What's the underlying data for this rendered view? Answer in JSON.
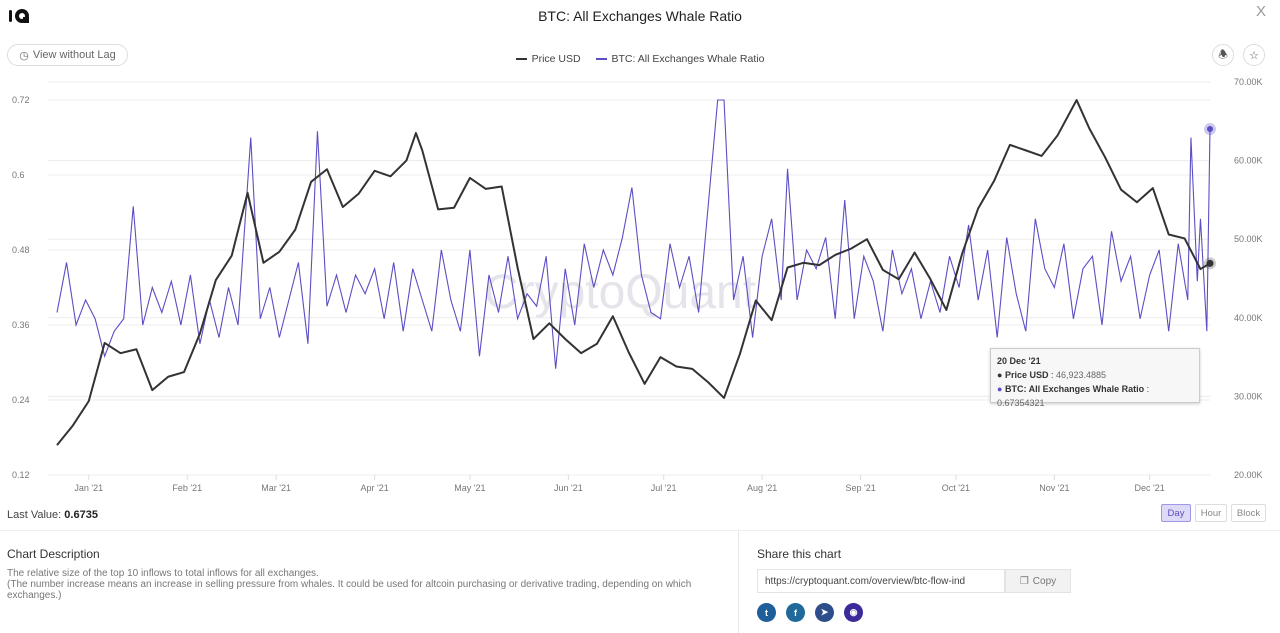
{
  "header": {
    "title": "BTC: All Exchanges Whale Ratio",
    "close_label": "X",
    "view_without_lag": "View without Lag"
  },
  "icons": {
    "logo": "cryptoquant-logo",
    "alert": "bell-icon",
    "favorite": "star-icon",
    "clock": "clock-icon",
    "copy": "copy-icon"
  },
  "colors": {
    "price": "#333333",
    "ratio": "#5b4fc4",
    "accent": "#5b4fc4"
  },
  "watermark": "CryptoQuant",
  "tooltip": {
    "date": "20 Dec '21",
    "price_label": "Price USD",
    "price_value": "46,923.4885",
    "ratio_label": "BTC: All Exchanges Whale Ratio",
    "ratio_value": "0.67354321"
  },
  "footer": {
    "last_value_label": "Last Value:",
    "last_value": "0.6735",
    "resolutions": [
      "Day",
      "Hour",
      "Block"
    ],
    "active_resolution": "Day"
  },
  "description": {
    "title": "Chart Description",
    "line1": "The relative size of the top 10 inflows to total inflows for all exchanges.",
    "line2": "(The number increase means an increase in selling pressure from whales. It could be used for altcoin purchasing or derivative trading, depending on which exchanges.)"
  },
  "share": {
    "title": "Share this chart",
    "url": "https://cryptoquant.com/overview/btc-flow-ind",
    "copy_label": "Copy",
    "networks": [
      "twitter",
      "facebook",
      "telegram",
      "camera"
    ]
  },
  "chart_data": {
    "type": "line",
    "title": "BTC: All Exchanges Whale Ratio",
    "legend": [
      "Price USD",
      "BTC: All Exchanges Whale Ratio"
    ],
    "legend_position": "top",
    "grid": true,
    "x_ticks": [
      "Jan '21",
      "Feb '21",
      "Mar '21",
      "Apr '21",
      "May '21",
      "Jun '21",
      "Jul '21",
      "Aug '21",
      "Sep '21",
      "Oct '21",
      "Nov '21",
      "Dec '21"
    ],
    "x_tick_dates": [
      "2021-01-01",
      "2021-02-01",
      "2021-03-01",
      "2021-04-01",
      "2021-05-01",
      "2021-06-01",
      "2021-07-01",
      "2021-08-01",
      "2021-09-01",
      "2021-10-01",
      "2021-11-01",
      "2021-12-01"
    ],
    "xlim": [
      "2020-12-22",
      "2021-12-20"
    ],
    "y_left": {
      "ticks": [
        "0.12",
        "0.24",
        "0.36",
        "0.48",
        "0.6",
        "0.72"
      ],
      "ylim": [
        0.12,
        0.72
      ]
    },
    "y_right": {
      "ticks": [
        "20.00K",
        "30.00K",
        "40.00K",
        "50.00K",
        "60.00K",
        "70.00K"
      ],
      "ylim": [
        20000,
        70000
      ]
    },
    "series": [
      {
        "name": "Price USD",
        "axis": "right",
        "points": [
          [
            "2020-12-22",
            23800
          ],
          [
            "2020-12-27",
            26300
          ],
          [
            "2021-01-01",
            29400
          ],
          [
            "2021-01-06",
            36800
          ],
          [
            "2021-01-11",
            35500
          ],
          [
            "2021-01-16",
            36000
          ],
          [
            "2021-01-21",
            30800
          ],
          [
            "2021-01-26",
            32500
          ],
          [
            "2021-01-31",
            33100
          ],
          [
            "2021-02-05",
            38000
          ],
          [
            "2021-02-10",
            44800
          ],
          [
            "2021-02-15",
            47900
          ],
          [
            "2021-02-20",
            55900
          ],
          [
            "2021-02-25",
            47000
          ],
          [
            "2021-03-02",
            48400
          ],
          [
            "2021-03-07",
            51200
          ],
          [
            "2021-03-12",
            57300
          ],
          [
            "2021-03-17",
            58900
          ],
          [
            "2021-03-22",
            54100
          ],
          [
            "2021-03-27",
            55800
          ],
          [
            "2021-04-01",
            58700
          ],
          [
            "2021-04-06",
            58000
          ],
          [
            "2021-04-11",
            60000
          ],
          [
            "2021-04-14",
            63500
          ],
          [
            "2021-04-16",
            61300
          ],
          [
            "2021-04-21",
            53800
          ],
          [
            "2021-04-26",
            54000
          ],
          [
            "2021-05-01",
            57800
          ],
          [
            "2021-05-06",
            56400
          ],
          [
            "2021-05-11",
            56700
          ],
          [
            "2021-05-16",
            46400
          ],
          [
            "2021-05-21",
            37300
          ],
          [
            "2021-05-26",
            39300
          ],
          [
            "2021-05-31",
            37300
          ],
          [
            "2021-06-05",
            35500
          ],
          [
            "2021-06-10",
            36700
          ],
          [
            "2021-06-15",
            40200
          ],
          [
            "2021-06-20",
            35600
          ],
          [
            "2021-06-25",
            31600
          ],
          [
            "2021-06-30",
            35000
          ],
          [
            "2021-07-05",
            33800
          ],
          [
            "2021-07-10",
            33500
          ],
          [
            "2021-07-15",
            31800
          ],
          [
            "2021-07-20",
            29800
          ],
          [
            "2021-07-25",
            35400
          ],
          [
            "2021-07-30",
            42200
          ],
          [
            "2021-08-04",
            39700
          ],
          [
            "2021-08-09",
            46400
          ],
          [
            "2021-08-14",
            47000
          ],
          [
            "2021-08-19",
            46700
          ],
          [
            "2021-08-24",
            48000
          ],
          [
            "2021-08-29",
            48800
          ],
          [
            "2021-09-03",
            50000
          ],
          [
            "2021-09-08",
            46100
          ],
          [
            "2021-09-13",
            44900
          ],
          [
            "2021-09-18",
            48300
          ],
          [
            "2021-09-23",
            44900
          ],
          [
            "2021-09-28",
            41000
          ],
          [
            "2021-10-03",
            48200
          ],
          [
            "2021-10-08",
            53900
          ],
          [
            "2021-10-13",
            57400
          ],
          [
            "2021-10-18",
            62000
          ],
          [
            "2021-10-23",
            61300
          ],
          [
            "2021-10-28",
            60600
          ],
          [
            "2021-11-02",
            63200
          ],
          [
            "2021-11-08",
            67700
          ],
          [
            "2021-11-12",
            64100
          ],
          [
            "2021-11-17",
            60400
          ],
          [
            "2021-11-22",
            56300
          ],
          [
            "2021-11-27",
            54700
          ],
          [
            "2021-12-02",
            56500
          ],
          [
            "2021-12-07",
            50600
          ],
          [
            "2021-12-12",
            50100
          ],
          [
            "2021-12-17",
            46200
          ],
          [
            "2021-12-20",
            46923.4885
          ]
        ]
      },
      {
        "name": "BTC: All Exchanges Whale Ratio",
        "axis": "left",
        "points": [
          [
            "2020-12-22",
            0.38
          ],
          [
            "2020-12-25",
            0.46
          ],
          [
            "2020-12-28",
            0.36
          ],
          [
            "2020-12-31",
            0.4
          ],
          [
            "2021-01-03",
            0.37
          ],
          [
            "2021-01-06",
            0.31
          ],
          [
            "2021-01-09",
            0.35
          ],
          [
            "2021-01-12",
            0.37
          ],
          [
            "2021-01-15",
            0.55
          ],
          [
            "2021-01-18",
            0.36
          ],
          [
            "2021-01-21",
            0.42
          ],
          [
            "2021-01-24",
            0.38
          ],
          [
            "2021-01-27",
            0.43
          ],
          [
            "2021-01-30",
            0.36
          ],
          [
            "2021-02-02",
            0.44
          ],
          [
            "2021-02-05",
            0.33
          ],
          [
            "2021-02-08",
            0.4
          ],
          [
            "2021-02-11",
            0.34
          ],
          [
            "2021-02-14",
            0.42
          ],
          [
            "2021-02-17",
            0.36
          ],
          [
            "2021-02-21",
            0.66
          ],
          [
            "2021-02-24",
            0.37
          ],
          [
            "2021-02-27",
            0.42
          ],
          [
            "2021-03-02",
            0.34
          ],
          [
            "2021-03-05",
            0.4
          ],
          [
            "2021-03-08",
            0.46
          ],
          [
            "2021-03-11",
            0.33
          ],
          [
            "2021-03-14",
            0.67
          ],
          [
            "2021-03-17",
            0.39
          ],
          [
            "2021-03-20",
            0.44
          ],
          [
            "2021-03-23",
            0.38
          ],
          [
            "2021-03-26",
            0.44
          ],
          [
            "2021-03-29",
            0.41
          ],
          [
            "2021-04-01",
            0.45
          ],
          [
            "2021-04-04",
            0.37
          ],
          [
            "2021-04-07",
            0.46
          ],
          [
            "2021-04-10",
            0.35
          ],
          [
            "2021-04-13",
            0.45
          ],
          [
            "2021-04-16",
            0.4
          ],
          [
            "2021-04-19",
            0.35
          ],
          [
            "2021-04-22",
            0.48
          ],
          [
            "2021-04-25",
            0.4
          ],
          [
            "2021-04-28",
            0.35
          ],
          [
            "2021-05-01",
            0.48
          ],
          [
            "2021-05-04",
            0.31
          ],
          [
            "2021-05-07",
            0.44
          ],
          [
            "2021-05-10",
            0.38
          ],
          [
            "2021-05-13",
            0.47
          ],
          [
            "2021-05-16",
            0.37
          ],
          [
            "2021-05-19",
            0.41
          ],
          [
            "2021-05-22",
            0.39
          ],
          [
            "2021-05-25",
            0.47
          ],
          [
            "2021-05-28",
            0.29
          ],
          [
            "2021-05-31",
            0.45
          ],
          [
            "2021-06-03",
            0.36
          ],
          [
            "2021-06-06",
            0.49
          ],
          [
            "2021-06-09",
            0.42
          ],
          [
            "2021-06-12",
            0.48
          ],
          [
            "2021-06-15",
            0.44
          ],
          [
            "2021-06-18",
            0.5
          ],
          [
            "2021-06-21",
            0.58
          ],
          [
            "2021-06-24",
            0.44
          ],
          [
            "2021-06-27",
            0.38
          ],
          [
            "2021-06-30",
            0.37
          ],
          [
            "2021-07-03",
            0.49
          ],
          [
            "2021-07-06",
            0.42
          ],
          [
            "2021-07-09",
            0.47
          ],
          [
            "2021-07-12",
            0.38
          ],
          [
            "2021-07-15",
            0.55
          ],
          [
            "2021-07-18",
            0.72
          ],
          [
            "2021-07-20",
            0.72
          ],
          [
            "2021-07-23",
            0.4
          ],
          [
            "2021-07-26",
            0.47
          ],
          [
            "2021-07-29",
            0.34
          ],
          [
            "2021-08-01",
            0.47
          ],
          [
            "2021-08-04",
            0.53
          ],
          [
            "2021-08-07",
            0.4
          ],
          [
            "2021-08-09",
            0.61
          ],
          [
            "2021-08-12",
            0.4
          ],
          [
            "2021-08-15",
            0.48
          ],
          [
            "2021-08-18",
            0.45
          ],
          [
            "2021-08-21",
            0.5
          ],
          [
            "2021-08-24",
            0.37
          ],
          [
            "2021-08-27",
            0.56
          ],
          [
            "2021-08-30",
            0.37
          ],
          [
            "2021-09-02",
            0.47
          ],
          [
            "2021-09-05",
            0.43
          ],
          [
            "2021-09-08",
            0.35
          ],
          [
            "2021-09-11",
            0.48
          ],
          [
            "2021-09-14",
            0.41
          ],
          [
            "2021-09-17",
            0.45
          ],
          [
            "2021-09-20",
            0.37
          ],
          [
            "2021-09-23",
            0.43
          ],
          [
            "2021-09-26",
            0.38
          ],
          [
            "2021-09-29",
            0.47
          ],
          [
            "2021-10-02",
            0.42
          ],
          [
            "2021-10-05",
            0.52
          ],
          [
            "2021-10-08",
            0.4
          ],
          [
            "2021-10-11",
            0.48
          ],
          [
            "2021-10-14",
            0.34
          ],
          [
            "2021-10-17",
            0.5
          ],
          [
            "2021-10-20",
            0.41
          ],
          [
            "2021-10-23",
            0.35
          ],
          [
            "2021-10-26",
            0.53
          ],
          [
            "2021-10-29",
            0.45
          ],
          [
            "2021-11-01",
            0.42
          ],
          [
            "2021-11-04",
            0.49
          ],
          [
            "2021-11-07",
            0.37
          ],
          [
            "2021-11-10",
            0.45
          ],
          [
            "2021-11-13",
            0.47
          ],
          [
            "2021-11-16",
            0.36
          ],
          [
            "2021-11-19",
            0.51
          ],
          [
            "2021-11-22",
            0.43
          ],
          [
            "2021-11-25",
            0.47
          ],
          [
            "2021-11-28",
            0.37
          ],
          [
            "2021-12-01",
            0.44
          ],
          [
            "2021-12-04",
            0.48
          ],
          [
            "2021-12-07",
            0.35
          ],
          [
            "2021-12-10",
            0.49
          ],
          [
            "2021-12-13",
            0.4
          ],
          [
            "2021-12-14",
            0.66
          ],
          [
            "2021-12-16",
            0.43
          ],
          [
            "2021-12-17",
            0.53
          ],
          [
            "2021-12-19",
            0.35
          ],
          [
            "2021-12-20",
            0.67354321
          ]
        ]
      }
    ]
  }
}
